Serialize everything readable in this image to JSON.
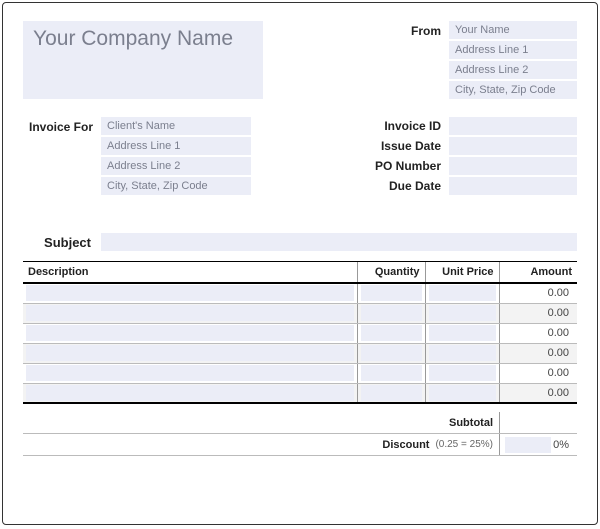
{
  "company_name": "Your Company Name",
  "from": {
    "label": "From",
    "name": "Your Name",
    "address1": "Address Line 1",
    "address2": "Address Line 2",
    "city_state_zip": "City, State, Zip Code"
  },
  "invoice_for": {
    "label": "Invoice For",
    "name": "Client's Name",
    "address1": "Address Line 1",
    "address2": "Address Line 2",
    "city_state_zip": "City, State, Zip Code"
  },
  "meta": {
    "invoice_id_label": "Invoice ID",
    "issue_date_label": "Issue Date",
    "po_number_label": "PO Number",
    "due_date_label": "Due Date",
    "invoice_id": "",
    "issue_date": "",
    "po_number": "",
    "due_date": ""
  },
  "subject": {
    "label": "Subject",
    "value": ""
  },
  "columns": {
    "description": "Description",
    "quantity": "Quantity",
    "unit_price": "Unit Price",
    "amount": "Amount"
  },
  "rows": [
    {
      "amount": "0.00"
    },
    {
      "amount": "0.00"
    },
    {
      "amount": "0.00"
    },
    {
      "amount": "0.00"
    },
    {
      "amount": "0.00"
    },
    {
      "amount": "0.00"
    }
  ],
  "totals": {
    "subtotal_label": "Subtotal",
    "subtotal_value": "",
    "discount_label": "Discount",
    "discount_hint": "(0.25 = 25%)",
    "discount_pct": "0%"
  }
}
